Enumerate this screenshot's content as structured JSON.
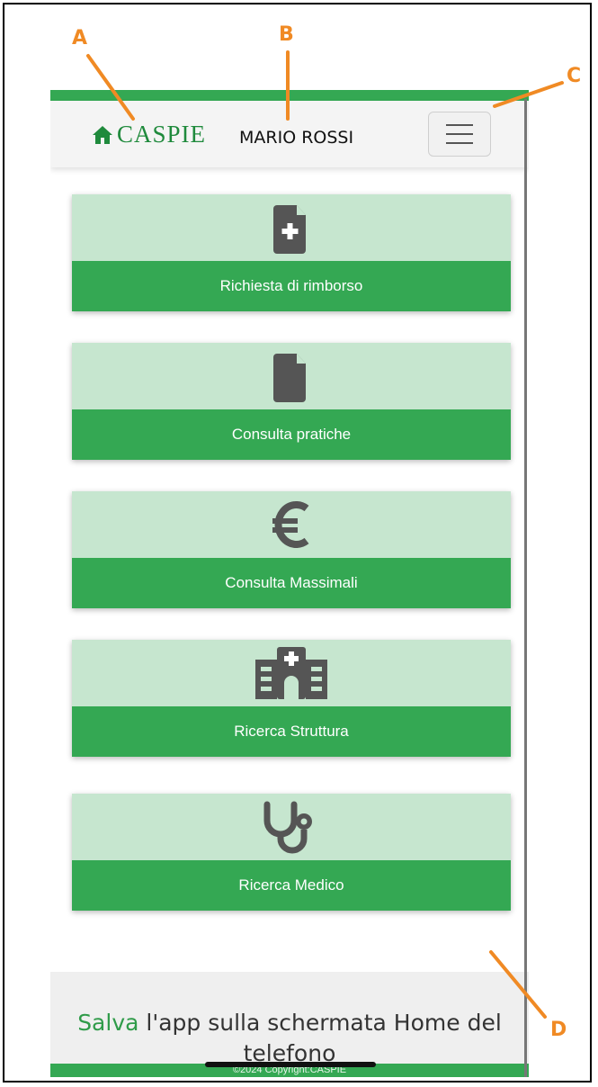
{
  "navbar": {
    "brand": "CASPIE",
    "user": "MARIO ROSSI",
    "menu_icon": "hamburger-icon"
  },
  "tiles": [
    {
      "label": "Richiesta di rimborso",
      "icon": "file-medical-icon"
    },
    {
      "label": "Consulta pratiche",
      "icon": "file-icon"
    },
    {
      "label": "Consulta Massimali",
      "icon": "euro-icon"
    },
    {
      "label": "Ricerca Struttura",
      "icon": "hospital-icon"
    },
    {
      "label": "Ricerca Medico",
      "icon": "stethoscope-icon"
    }
  ],
  "footer": {
    "save_link": "Salva",
    "message_line1": " l'app sulla schermata Home del",
    "message_line2": "telefono",
    "copyright": "©2024 Copyright:CASPIE"
  },
  "annotations": {
    "a": "A",
    "b": "B",
    "c": "C",
    "d": "D"
  },
  "colors": {
    "accent": "#34a853",
    "tile_bg": "#c6e6cf",
    "brand": "#1f8a3c",
    "annotation": "#f08a24",
    "icon": "#555555"
  }
}
